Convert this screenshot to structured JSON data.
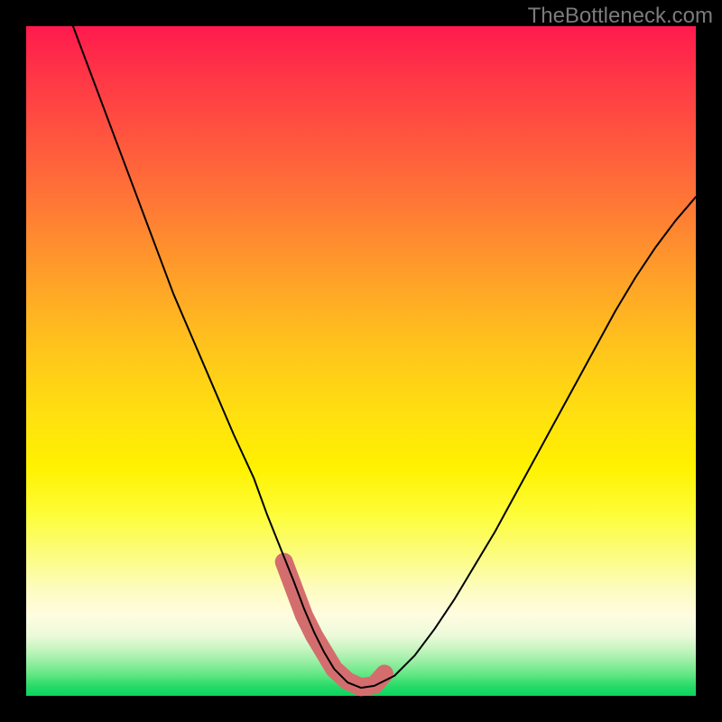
{
  "watermark": "TheBottleneck.com",
  "chart_data": {
    "type": "line",
    "title": "",
    "xlabel": "",
    "ylabel": "",
    "xlim": [
      0,
      100
    ],
    "ylim": [
      0,
      100
    ],
    "grid": false,
    "series": [
      {
        "name": "bottleneck-curve",
        "color": "#000000",
        "stroke_width": 2,
        "x": [
          7,
          10,
          13,
          16,
          19,
          22,
          25,
          28,
          31,
          34,
          36,
          38,
          40,
          41.5,
          43,
          44.5,
          46,
          48,
          50,
          52,
          55,
          58,
          61,
          64,
          67,
          70,
          73,
          76,
          79,
          82,
          85,
          88,
          91,
          94,
          97,
          100
        ],
        "y": [
          100,
          92,
          84,
          76,
          68,
          60,
          53,
          46,
          39,
          32.5,
          27,
          22,
          17,
          13,
          9.5,
          6.5,
          4,
          2,
          1.2,
          1.5,
          3,
          6,
          10,
          14.5,
          19.5,
          24.5,
          30,
          35.5,
          41,
          46.5,
          52,
          57.5,
          62.5,
          67,
          71,
          74.5
        ]
      },
      {
        "name": "highlight-band",
        "color": "#d46e6e",
        "stroke_width": 20,
        "x": [
          38.5,
          40,
          41.5,
          43,
          44.5,
          46,
          48,
          50,
          52,
          53.5
        ],
        "y": [
          20,
          16,
          12,
          9,
          6.5,
          4,
          2.2,
          1.3,
          1.6,
          3.3
        ]
      }
    ]
  }
}
